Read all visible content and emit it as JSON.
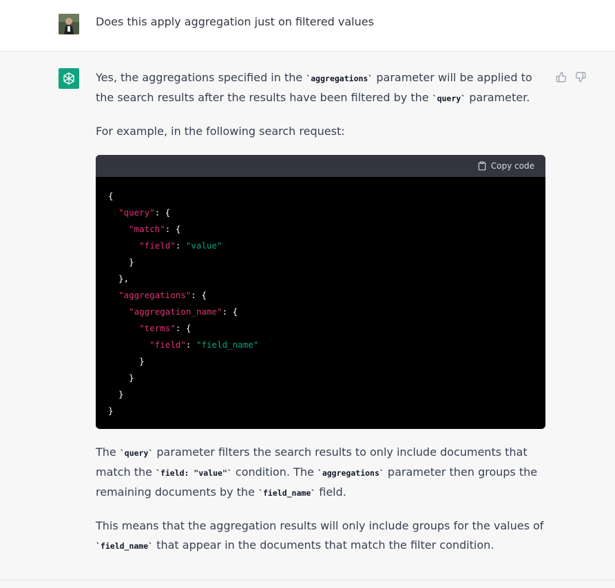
{
  "user_message": {
    "text": "Does this apply aggregation just on filtered values"
  },
  "assistant_message": {
    "p1": {
      "a": "Yes, the aggregations specified in the ",
      "code1": "`aggregations`",
      "b": " parameter will be applied to the search results after the results have been filtered by the ",
      "code2": "`query`",
      "c": " parameter."
    },
    "p2": "For example, in the following search request:",
    "codeblock": {
      "copy_label": "Copy code",
      "lines": [
        {
          "t": "{"
        },
        {
          "i": "  ",
          "k": "\"query\"",
          "t": ": {"
        },
        {
          "i": "    ",
          "k": "\"match\"",
          "t": ": {"
        },
        {
          "i": "      ",
          "k": "\"field\"",
          "t": ": ",
          "s": "\"value\""
        },
        {
          "t": "    }"
        },
        {
          "t": "  },"
        },
        {
          "i": "  ",
          "k": "\"aggregations\"",
          "t": ": {"
        },
        {
          "i": "    ",
          "k": "\"aggregation_name\"",
          "t": ": {"
        },
        {
          "i": "      ",
          "k": "\"terms\"",
          "t": ": {"
        },
        {
          "i": "        ",
          "k": "\"field\"",
          "t": ": ",
          "s": "\"field_name\""
        },
        {
          "t": "      }"
        },
        {
          "t": "    }"
        },
        {
          "t": "  }"
        },
        {
          "t": "}"
        }
      ]
    },
    "p3": {
      "a": "The ",
      "code1": "`query`",
      "b": " parameter filters the search results to only include documents that match the ",
      "code2": "`field: \"value\"`",
      "c": " condition. The ",
      "code3": "`aggregations`",
      "d": " parameter then groups the remaining documents by the ",
      "code4": "`field_name`",
      "e": " field."
    },
    "p4": {
      "a": "This means that the aggregation results will only include groups for the values of ",
      "code1": "`field_name`",
      "b": " that appear in the documents that match the filter condition."
    }
  },
  "icons": {
    "user_avatar": "user-avatar-photo",
    "ai_avatar": "openai-logo-icon",
    "like": "thumbs-up-icon",
    "dislike": "thumbs-down-icon",
    "copy": "clipboard-icon"
  },
  "colors": {
    "ai_avatar_bg": "#10a37f",
    "code_key": "#df3079",
    "code_string": "#00a67d",
    "code_header_bg": "#343541"
  }
}
